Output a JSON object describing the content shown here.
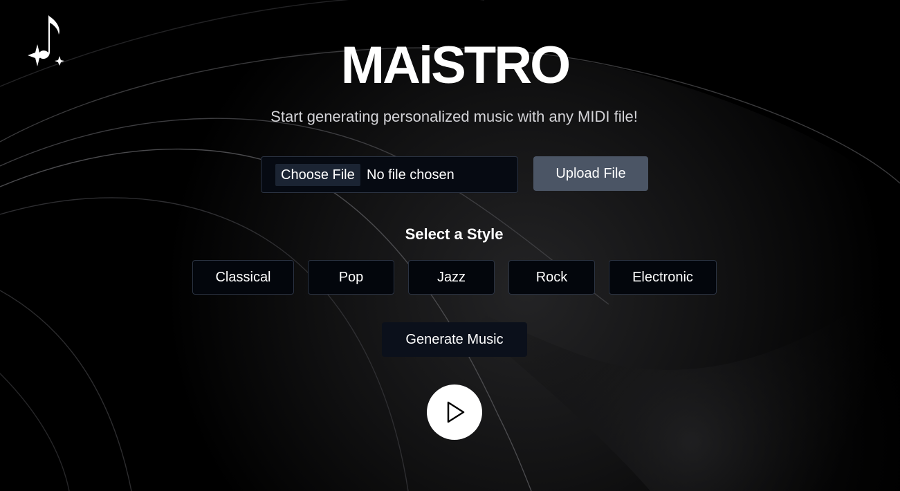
{
  "header": {
    "title": "MAiSTRO",
    "subtitle": "Start generating personalized music with any MIDI file!",
    "logo_icon": "music-note-sparkle-icon"
  },
  "upload": {
    "choose_file_label": "Choose File",
    "file_status": "No file chosen",
    "upload_button_label": "Upload File"
  },
  "styles": {
    "heading": "Select a Style",
    "options": [
      "Classical",
      "Pop",
      "Jazz",
      "Rock",
      "Electronic"
    ]
  },
  "actions": {
    "generate_label": "Generate Music",
    "play_icon": "play-icon"
  },
  "colors": {
    "background": "#000000",
    "upload_button": "#4b5565",
    "button_border": "#2b3342",
    "generate_button": "#0b101b"
  }
}
